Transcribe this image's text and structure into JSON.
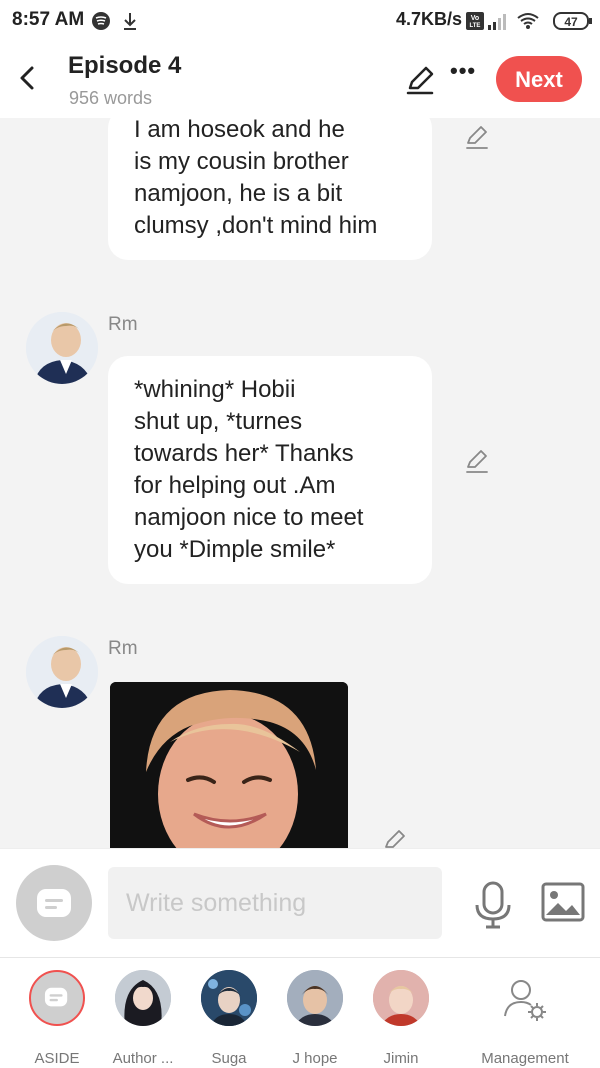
{
  "status_bar": {
    "time": "8:57 AM",
    "speed": "4.7KB/s",
    "battery": "47"
  },
  "header": {
    "title": "Episode 4",
    "subtitle": "956 words",
    "next_label": "Next"
  },
  "messages": [
    {
      "speaker": "",
      "text": "I am hoseok and he is my cousin brother namjoon, he is a bit clumsy ,don't mind him",
      "lines": [
        "I am hoseok and he",
        "is my cousin brother",
        "namjoon, he is a bit",
        "clumsy ,don't mind him"
      ]
    },
    {
      "speaker": "Rm",
      "lines": [
        "*whining* Hobii",
        "shut up, *turnes",
        "towards her* Thanks",
        "for helping out .Am",
        "namjoon nice to meet",
        "you *Dimple smile*"
      ]
    },
    {
      "speaker": "Rm",
      "type": "image"
    }
  ],
  "composer": {
    "placeholder": "Write something"
  },
  "bottom_tabs": [
    {
      "label": "ASIDE"
    },
    {
      "label": "Author ..."
    },
    {
      "label": "Suga"
    },
    {
      "label": "J hope"
    },
    {
      "label": "Jimin"
    },
    {
      "label": "Management"
    }
  ],
  "colors": {
    "accent": "#f0514f",
    "background": "#f3f3f3"
  }
}
